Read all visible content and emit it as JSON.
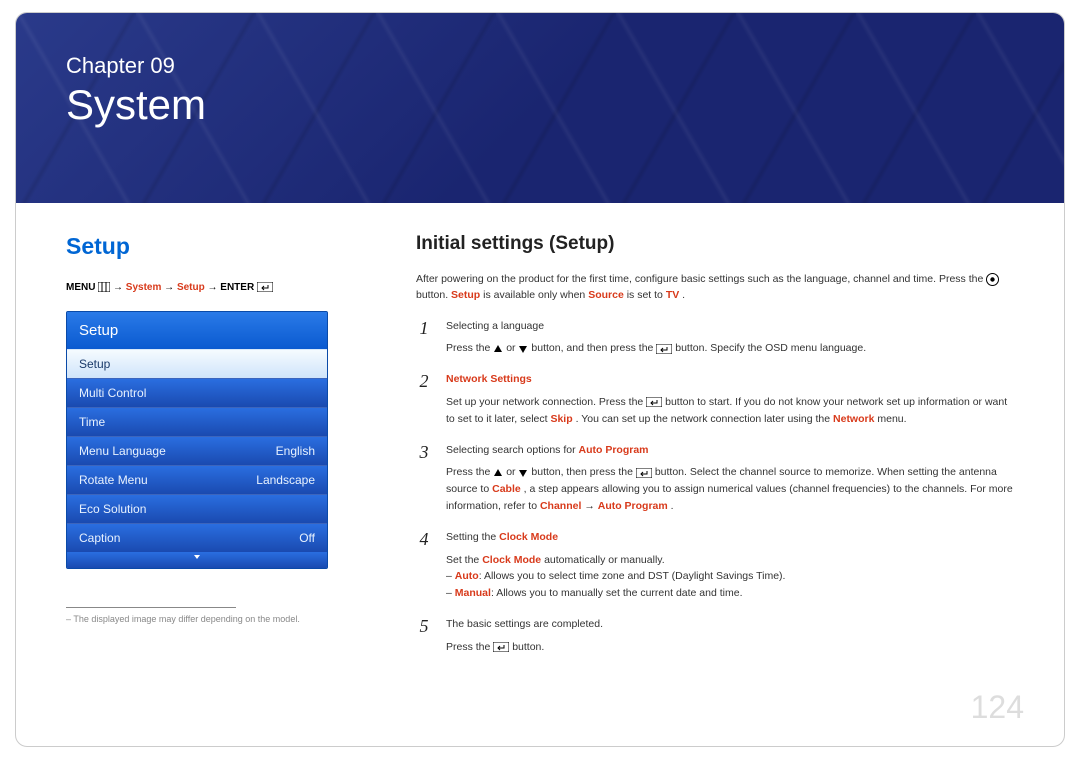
{
  "chapter": {
    "label": "Chapter 09",
    "title": "System"
  },
  "left": {
    "heading": "Setup",
    "breadcrumb": {
      "menu": "MENU",
      "arrow": "→",
      "system": "System",
      "setup": "Setup",
      "enter": "ENTER"
    },
    "menu": {
      "header": "Setup",
      "items": [
        {
          "label": "Setup",
          "value": "",
          "selected": true
        },
        {
          "label": "Multi Control",
          "value": ""
        },
        {
          "label": "Time",
          "value": ""
        },
        {
          "label": "Menu Language",
          "value": "English"
        },
        {
          "label": "Rotate Menu",
          "value": "Landscape"
        },
        {
          "label": "Eco Solution",
          "value": ""
        },
        {
          "label": "Caption",
          "value": "Off"
        }
      ]
    },
    "footnote": "The displayed image may differ depending on the model."
  },
  "right": {
    "heading": "Initial settings (Setup)",
    "lead_a": "After powering on the product for the first time, configure basic settings such as the language, channel and time. Press the ",
    "lead_b": " button. ",
    "lead_setup": "Setup",
    "lead_c": " is available only when ",
    "lead_source": "Source",
    "lead_d": " is set to ",
    "lead_tv": "TV",
    "lead_e": ".",
    "steps": [
      {
        "num": "1",
        "title": "Selecting a language",
        "body_a": "Press the ",
        "body_b": " or ",
        "body_c": " button, and then press the ",
        "body_d": " button. Specify the OSD menu language."
      },
      {
        "num": "2",
        "title_red": "Network Settings",
        "body_a": "Set up your network connection. Press the ",
        "body_b": " button to start. If you do not know your network set up information or want to set to it later, select ",
        "skip": "Skip",
        "body_c": ". You can set up the network connection later using the ",
        "network": "Network",
        "body_d": " menu."
      },
      {
        "num": "3",
        "title_a": "Selecting search options for ",
        "title_red": "Auto Program",
        "body_a": "Press the ",
        "body_b": " or ",
        "body_c": " button, then press the ",
        "body_d": " button.  Select the channel source to memorize. When setting the antenna source to ",
        "cable": "Cable",
        "body_e": ", a step appears allowing you to assign numerical values (channel frequencies) to the channels. For more information, refer to ",
        "channel": "Channel",
        "arrow": "→",
        "autoprog": "Auto Program",
        "body_f": "."
      },
      {
        "num": "4",
        "title_a": "Setting the ",
        "title_red": "Clock Mode",
        "body_a": "Set the ",
        "clockmode": "Clock Mode",
        "body_b": " automatically or manually.",
        "bullet1_a": "Auto",
        "bullet1_b": ": Allows you to select time zone and DST (Daylight Savings Time).",
        "bullet2_a": "Manual",
        "bullet2_b": ": Allows you to manually set the current date and time."
      },
      {
        "num": "5",
        "title": "The basic settings are completed.",
        "body_a": "Press the ",
        "body_b": " button."
      }
    ]
  },
  "pageNumber": "124"
}
